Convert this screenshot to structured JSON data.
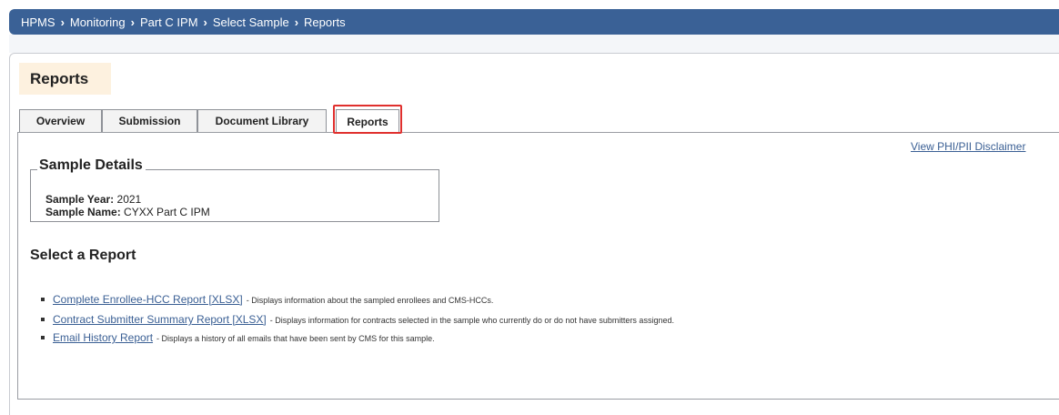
{
  "breadcrumb": [
    "HPMS",
    "Monitoring",
    "Part C IPM",
    "Select Sample",
    "Reports"
  ],
  "page_title": "Reports",
  "tabs": [
    {
      "label": "Overview"
    },
    {
      "label": "Submission"
    },
    {
      "label": "Document Library"
    },
    {
      "label": "Reports",
      "active": true
    }
  ],
  "disclaimer_link": "View PHI/PII Disclaimer",
  "sample_details": {
    "legend": "Sample Details",
    "year_label": "Sample Year:",
    "year_value": "2021",
    "name_label": "Sample Name:",
    "name_value": "CYXX Part C IPM"
  },
  "select_report_title": "Select a Report",
  "reports": [
    {
      "link": "Complete Enrollee-HCC Report [XLSX]",
      "desc": "- Displays information about the sampled enrollees and CMS-HCCs."
    },
    {
      "link": "Contract Submitter Summary Report [XLSX]",
      "desc": "- Displays information for contracts selected in the sample who currently do or do not have submitters assigned."
    },
    {
      "link": "Email History Report",
      "desc": "- Displays a history of all emails that have been sent by CMS for this sample."
    }
  ],
  "colors": {
    "topbar": "#3a6196",
    "link": "#3a5f94",
    "highlight": "#e0302e",
    "title_bg": "#fdf1df"
  }
}
